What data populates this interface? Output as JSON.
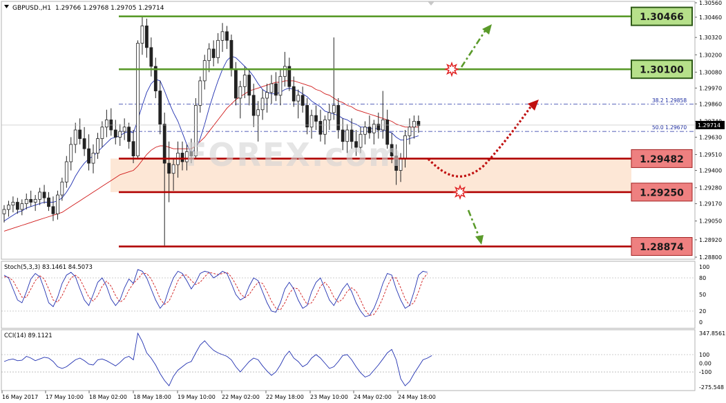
{
  "header": {
    "symbol": "GBPUSD.,H1",
    "ohlc": "1.29766 1.29768 1.29705 1.29714"
  },
  "price_axis": {
    "ticks": [
      "1.30560",
      "1.30460",
      "1.30320",
      "1.30200",
      "1.30080",
      "1.29970",
      "1.29860",
      "1.29740",
      "1.29630",
      "1.29510",
      "1.29400",
      "1.29280",
      "1.29170",
      "1.29050",
      "1.28920",
      "1.28800"
    ],
    "current_price": "1.29714"
  },
  "levels": [
    {
      "label": "1.30466",
      "kind": "resistance"
    },
    {
      "label": "1.30100",
      "kind": "resistance"
    },
    {
      "label": "1.29482",
      "kind": "support"
    },
    {
      "label": "1.29250",
      "kind": "support"
    },
    {
      "label": "1.28874",
      "kind": "support"
    }
  ],
  "fibonacci": [
    {
      "ratio": "38.2",
      "price": "1.29858"
    },
    {
      "ratio": "50.0",
      "price": "1.29670"
    }
  ],
  "time_axis": [
    "16 May 2017",
    "17 May 10:00",
    "18 May 02:00",
    "18 May 18:00",
    "19 May 10:00",
    "22 May 02:00",
    "22 May 18:00",
    "23 May 10:00",
    "24 May 02:00",
    "24 May 18:00"
  ],
  "watermark": "FOREX.com",
  "stochastic": {
    "label": "Stoch(5,3,3) 83.1461 84.5073",
    "ticks": [
      "100",
      "80",
      "50",
      "20",
      "0"
    ]
  },
  "cci": {
    "label": "CCI(14) 89.1121",
    "ticks": [
      "347.8561",
      "100",
      "0.00",
      "-100",
      "-275.548"
    ]
  },
  "colors": {
    "bull": "#1a1a1a",
    "bear": "#1a1a1a",
    "ma_fast": "#1f2fb0",
    "ma_slow": "#d01818",
    "resistance": "#5a9a2a",
    "resistance_fill": "#b6e08a",
    "support": "#b00000",
    "support_fill": "#ee8080",
    "zone": "#fde3cf",
    "fib": "#1a2aa0"
  },
  "chart_data": {
    "type": "candlestick",
    "symbol": "GBPUSD",
    "timeframe": "H1",
    "ylim": [
      1.288,
      1.3056
    ],
    "candles": [
      [
        1.291,
        1.2916,
        1.2904,
        1.2913
      ],
      [
        1.2913,
        1.2919,
        1.2908,
        1.2916
      ],
      [
        1.2916,
        1.2922,
        1.2911,
        1.2918
      ],
      [
        1.2918,
        1.2921,
        1.291,
        1.2913
      ],
      [
        1.2913,
        1.292,
        1.2909,
        1.2917
      ],
      [
        1.2917,
        1.2924,
        1.2913,
        1.292
      ],
      [
        1.292,
        1.2926,
        1.2915,
        1.2918
      ],
      [
        1.2918,
        1.2923,
        1.2912,
        1.292
      ],
      [
        1.292,
        1.2928,
        1.2916,
        1.2925
      ],
      [
        1.2925,
        1.293,
        1.2917,
        1.2921
      ],
      [
        1.2921,
        1.2925,
        1.2912,
        1.2915
      ],
      [
        1.2915,
        1.2922,
        1.2905,
        1.291
      ],
      [
        1.291,
        1.2926,
        1.2906,
        1.2923
      ],
      [
        1.2923,
        1.2935,
        1.2919,
        1.2932
      ],
      [
        1.2932,
        1.295,
        1.2928,
        1.2946
      ],
      [
        1.2946,
        1.2963,
        1.294,
        1.2958
      ],
      [
        1.2958,
        1.2973,
        1.2952,
        1.2968
      ],
      [
        1.2968,
        1.2976,
        1.2958,
        1.2962
      ],
      [
        1.2962,
        1.297,
        1.295,
        1.2955
      ],
      [
        1.2955,
        1.2965,
        1.294,
        1.2945
      ],
      [
        1.2945,
        1.2958,
        1.2938,
        1.2952
      ],
      [
        1.2952,
        1.2966,
        1.2948,
        1.2962
      ],
      [
        1.2962,
        1.2974,
        1.2956,
        1.297
      ],
      [
        1.297,
        1.2982,
        1.2963,
        1.2975
      ],
      [
        1.2975,
        1.2983,
        1.2964,
        1.2968
      ],
      [
        1.2968,
        1.2975,
        1.2958,
        1.2963
      ],
      [
        1.2963,
        1.2972,
        1.2957,
        1.2967
      ],
      [
        1.2967,
        1.2976,
        1.2961,
        1.297
      ],
      [
        1.297,
        1.2973,
        1.2955,
        1.296
      ],
      [
        1.296,
        1.2968,
        1.2945,
        1.295
      ],
      [
        1.295,
        1.303,
        1.2948,
        1.3028
      ],
      [
        1.3028,
        1.3047,
        1.302,
        1.304
      ],
      [
        1.304,
        1.3045,
        1.3018,
        1.3025
      ],
      [
        1.3025,
        1.3032,
        1.3005,
        1.3012
      ],
      [
        1.3012,
        1.3018,
        1.299,
        1.2995
      ],
      [
        1.2995,
        1.3002,
        1.2965,
        1.2972
      ],
      [
        1.2972,
        1.298,
        1.2888,
        1.2945
      ],
      [
        1.2945,
        1.296,
        1.2918,
        1.2938
      ],
      [
        1.2938,
        1.2948,
        1.2926,
        1.2944
      ],
      [
        1.2944,
        1.296,
        1.2935,
        1.2952
      ],
      [
        1.2952,
        1.296,
        1.294,
        1.2946
      ],
      [
        1.2946,
        1.2958,
        1.294,
        1.2953
      ],
      [
        1.2953,
        1.2962,
        1.2945,
        1.295
      ],
      [
        1.295,
        1.299,
        1.2948,
        1.2985
      ],
      [
        1.2985,
        1.3005,
        1.298,
        1.3002
      ],
      [
        1.3002,
        1.302,
        1.2996,
        1.3016
      ],
      [
        1.3016,
        1.3028,
        1.3008,
        1.3024
      ],
      [
        1.3024,
        1.303,
        1.3012,
        1.3018
      ],
      [
        1.3018,
        1.3035,
        1.3014,
        1.303
      ],
      [
        1.303,
        1.3042,
        1.3022,
        1.3036
      ],
      [
        1.3036,
        1.304,
        1.3024,
        1.303
      ],
      [
        1.303,
        1.3034,
        1.3005,
        1.301
      ],
      [
        1.301,
        1.3015,
        1.2985,
        1.299
      ],
      [
        1.299,
        1.3002,
        1.2976,
        1.2998
      ],
      [
        1.2998,
        1.3012,
        1.299,
        1.3006
      ],
      [
        1.3006,
        1.301,
        1.2985,
        1.2992
      ],
      [
        1.2992,
        1.3,
        1.297,
        1.2978
      ],
      [
        1.2978,
        1.2988,
        1.296,
        1.2982
      ],
      [
        1.2982,
        1.2996,
        1.2975,
        1.299
      ],
      [
        1.299,
        1.3,
        1.298,
        1.2994
      ],
      [
        1.2994,
        1.3006,
        1.2986,
        1.3
      ],
      [
        1.3,
        1.3008,
        1.2988,
        1.2992
      ],
      [
        1.2992,
        1.301,
        1.2985,
        1.3005
      ],
      [
        1.3005,
        1.3022,
        1.2998,
        1.3012
      ],
      [
        1.3012,
        1.3018,
        1.2995,
        1.2998
      ],
      [
        1.2998,
        1.3005,
        1.2984,
        1.2988
      ],
      [
        1.2988,
        1.2996,
        1.2976,
        1.2992
      ],
      [
        1.2992,
        1.2998,
        1.298,
        1.2985
      ],
      [
        1.2985,
        1.299,
        1.2965,
        1.297
      ],
      [
        1.297,
        1.2982,
        1.2962,
        1.2978
      ],
      [
        1.2978,
        1.2985,
        1.2968,
        1.2974
      ],
      [
        1.2974,
        1.2982,
        1.296,
        1.2965
      ],
      [
        1.2965,
        1.2978,
        1.2958,
        1.2975
      ],
      [
        1.2975,
        1.2986,
        1.2968,
        1.298
      ],
      [
        1.298,
        1.3032,
        1.2975,
        1.2985
      ],
      [
        1.2985,
        1.299,
        1.2962,
        1.2968
      ],
      [
        1.2968,
        1.2976,
        1.2954,
        1.296
      ],
      [
        1.296,
        1.2972,
        1.2952,
        1.2968
      ],
      [
        1.2968,
        1.2976,
        1.2955,
        1.296
      ],
      [
        1.296,
        1.2968,
        1.295,
        1.2956
      ],
      [
        1.2956,
        1.297,
        1.2952,
        1.2965
      ],
      [
        1.2965,
        1.2974,
        1.2958,
        1.297
      ],
      [
        1.297,
        1.2978,
        1.2962,
        1.2966
      ],
      [
        1.2966,
        1.2975,
        1.2958,
        1.2972
      ],
      [
        1.2972,
        1.298,
        1.2962,
        1.2968
      ],
      [
        1.2968,
        1.2995,
        1.2962,
        1.2975
      ],
      [
        1.2975,
        1.2982,
        1.2955,
        1.2958
      ],
      [
        1.2958,
        1.2966,
        1.2945,
        1.295
      ],
      [
        1.295,
        1.2958,
        1.293,
        1.294
      ],
      [
        1.294,
        1.2952,
        1.2932,
        1.2948
      ],
      [
        1.2948,
        1.2968,
        1.2942,
        1.2964
      ],
      [
        1.2964,
        1.2976,
        1.2958,
        1.297
      ],
      [
        1.297,
        1.2978,
        1.2962,
        1.2974
      ],
      [
        1.2974,
        1.2978,
        1.2966,
        1.2971
      ]
    ],
    "ma_fast_values": [
      1.2905,
      1.2907,
      1.2909,
      1.2911,
      1.2912,
      1.2914,
      1.2915,
      1.2916,
      1.2917,
      1.2918,
      1.2918,
      1.2918,
      1.2919,
      1.2921,
      1.2925,
      1.293,
      1.2936,
      1.2941,
      1.2945,
      1.2948,
      1.295,
      1.2953,
      1.2956,
      1.2959,
      1.2962,
      1.2963,
      1.2964,
      1.2966,
      1.2967,
      1.2966,
      1.2975,
      1.2985,
      1.2994,
      1.3,
      1.3003,
      1.3002,
      1.2995,
      1.2987,
      1.298,
      1.2974,
      1.2966,
      1.2958,
      1.2952,
      1.2955,
      1.2962,
      1.2972,
      1.2983,
      1.2993,
      1.3002,
      1.301,
      1.3016,
      1.3019,
      1.3018,
      1.3015,
      1.3012,
      1.3009,
      1.3005,
      1.3,
      1.2996,
      1.2994,
      1.2993,
      1.2993,
      1.2994,
      1.2996,
      1.2997,
      1.2996,
      1.2995,
      1.2993,
      1.2991,
      1.2988,
      1.2986,
      1.2984,
      1.2981,
      1.298,
      1.2979,
      1.2978,
      1.2976,
      1.2975,
      1.2973,
      1.2972,
      1.297,
      1.297,
      1.2969,
      1.2969,
      1.2969,
      1.2968,
      1.2967,
      1.2966,
      1.2963,
      1.2961,
      1.2961,
      1.2962,
      1.2963,
      1.2964
    ],
    "ma_slow_values": [
      1.2898,
      1.2899,
      1.29,
      1.2901,
      1.2902,
      1.2903,
      1.2904,
      1.2905,
      1.2906,
      1.2907,
      1.2908,
      1.2909,
      1.291,
      1.2911,
      1.2913,
      1.2915,
      1.2917,
      1.2919,
      1.2921,
      1.2923,
      1.2925,
      1.2927,
      1.2929,
      1.2931,
      1.2933,
      1.2935,
      1.2937,
      1.2938,
      1.2939,
      1.294,
      1.2943,
      1.2947,
      1.2951,
      1.2954,
      1.2956,
      1.2957,
      1.2957,
      1.2956,
      1.2955,
      1.2955,
      1.2955,
      1.2955,
      1.2955,
      1.2957,
      1.296,
      1.2963,
      1.2967,
      1.2971,
      1.2975,
      1.2979,
      1.2983,
      1.2986,
      1.2989,
      1.2991,
      1.2993,
      1.2995,
      1.2996,
      1.2997,
      1.2998,
      1.2999,
      1.3,
      1.3001,
      1.3001,
      1.3002,
      1.3002,
      1.3002,
      1.3001,
      1.3,
      1.2999,
      1.2998,
      1.2996,
      1.2995,
      1.2993,
      1.2992,
      1.299,
      1.2988,
      1.2987,
      1.2985,
      1.2984,
      1.2982,
      1.2981,
      1.298,
      1.2979,
      1.2978,
      1.2977,
      1.2976,
      1.2975,
      1.2974,
      1.2972,
      1.2971,
      1.297,
      1.297,
      1.297,
      1.297
    ],
    "stoch_k": [
      85,
      80,
      60,
      40,
      35,
      55,
      78,
      88,
      82,
      60,
      35,
      28,
      45,
      70,
      85,
      90,
      82,
      60,
      40,
      30,
      50,
      72,
      80,
      65,
      42,
      30,
      40,
      62,
      78,
      70,
      95,
      92,
      80,
      60,
      40,
      25,
      35,
      60,
      80,
      92,
      88,
      75,
      60,
      72,
      88,
      92,
      90,
      80,
      85,
      92,
      88,
      70,
      50,
      40,
      45,
      65,
      80,
      75,
      55,
      35,
      20,
      18,
      35,
      60,
      72,
      60,
      40,
      25,
      30,
      55,
      72,
      80,
      60,
      40,
      30,
      45,
      60,
      70,
      55,
      35,
      20,
      10,
      12,
      25,
      45,
      70,
      88,
      85,
      60,
      40,
      25,
      30,
      55,
      85,
      92,
      90
    ],
    "stoch_d": [
      82,
      81,
      75,
      60,
      45,
      45,
      60,
      75,
      84,
      78,
      60,
      40,
      36,
      48,
      65,
      80,
      85,
      78,
      62,
      45,
      38,
      48,
      65,
      74,
      65,
      48,
      36,
      42,
      58,
      70,
      78,
      88,
      88,
      78,
      62,
      42,
      32,
      38,
      55,
      75,
      85,
      85,
      75,
      68,
      72,
      82,
      90,
      88,
      86,
      88,
      90,
      82,
      68,
      52,
      44,
      50,
      62,
      72,
      70,
      55,
      38,
      25,
      22,
      35,
      52,
      62,
      60,
      45,
      32,
      35,
      48,
      65,
      72,
      62,
      45,
      36,
      42,
      56,
      62,
      56,
      40,
      22,
      12,
      14,
      26,
      44,
      65,
      80,
      80,
      62,
      42,
      30,
      35,
      55,
      78,
      88
    ],
    "cci_values": [
      20,
      40,
      50,
      30,
      35,
      80,
      60,
      30,
      50,
      70,
      60,
      20,
      -40,
      -60,
      -40,
      0,
      40,
      60,
      30,
      -10,
      -20,
      40,
      50,
      30,
      0,
      -30,
      10,
      60,
      80,
      40,
      347,
      250,
      120,
      60,
      -20,
      -120,
      -200,
      -260,
      -150,
      -80,
      -40,
      0,
      20,
      120,
      210,
      260,
      200,
      150,
      120,
      100,
      80,
      40,
      -40,
      -100,
      -40,
      20,
      60,
      40,
      -30,
      -90,
      -140,
      -100,
      -20,
      80,
      140,
      60,
      20,
      -40,
      -10,
      60,
      100,
      60,
      0,
      -60,
      -40,
      20,
      90,
      100,
      40,
      -40,
      -110,
      -160,
      -140,
      -80,
      -20,
      50,
      120,
      160,
      40,
      -180,
      -260,
      -210,
      -120,
      -40,
      40,
      60,
      89
    ]
  }
}
